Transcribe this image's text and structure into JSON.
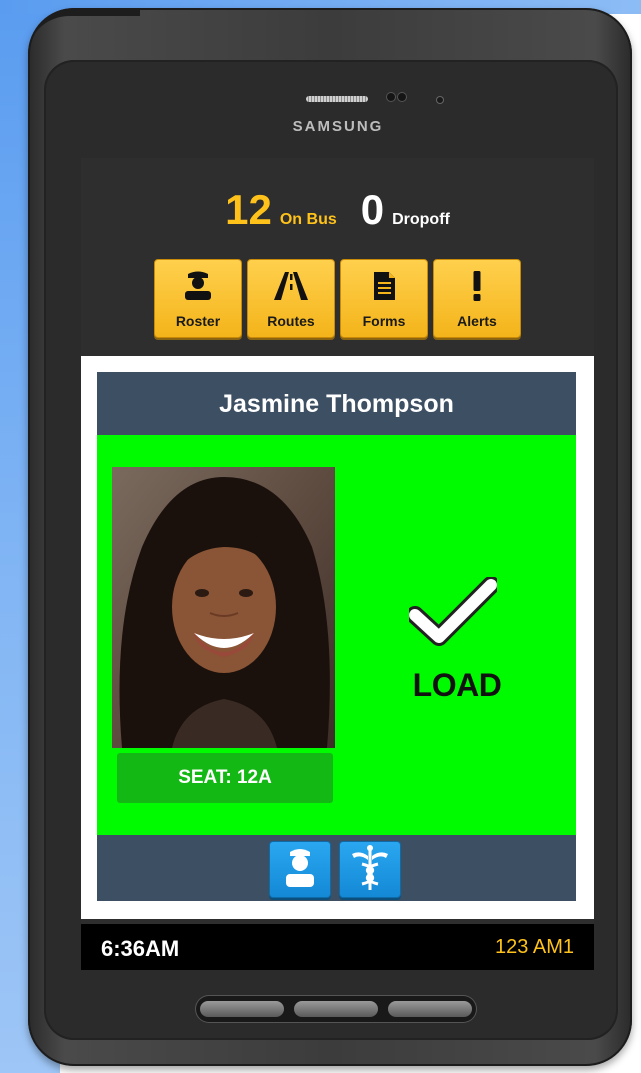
{
  "device": {
    "brand": "SAMSUNG"
  },
  "counts": {
    "on_bus_value": "12",
    "on_bus_label": "On Bus",
    "dropoff_value": "0",
    "dropoff_label": "Dropoff"
  },
  "nav": {
    "items": [
      {
        "label": "Roster",
        "icon": "driver-icon"
      },
      {
        "label": "Routes",
        "icon": "road-icon"
      },
      {
        "label": "Forms",
        "icon": "document-icon"
      },
      {
        "label": "Alerts",
        "icon": "exclamation-icon"
      }
    ]
  },
  "student": {
    "name": "Jasmine Thompson",
    "seat": "SEAT: 12A",
    "status": "LOAD",
    "status_color": "#00fa00"
  },
  "card_footer": {
    "buttons": [
      {
        "icon": "student-profile-icon"
      },
      {
        "icon": "medical-caduceus-icon"
      }
    ]
  },
  "status_bar": {
    "time": "6:36AM",
    "route": "123 AM1"
  },
  "colors": {
    "accent": "#ffc21a",
    "header_bar": "#3d4f63",
    "button_blue": "#1489d6"
  }
}
